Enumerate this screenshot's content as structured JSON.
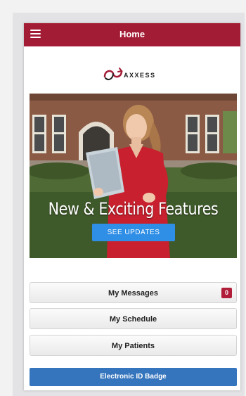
{
  "header": {
    "title": "Home",
    "background": "#a31c36",
    "menu_icon": "hamburger-icon"
  },
  "logo": {
    "text": "AXXESS",
    "accent": "#a31c36"
  },
  "hero": {
    "title": "New & Exciting Features",
    "button_label": "SEE UPDATES",
    "button_color": "#2f8ee5"
  },
  "menu": {
    "items": [
      {
        "label": "My Messages",
        "badge": "0"
      },
      {
        "label": "My Schedule"
      },
      {
        "label": "My Patients"
      }
    ],
    "badge_color": "#b01e3a"
  },
  "footer": {
    "id_badge_label": "Electronic ID Badge",
    "color": "#3575bd"
  }
}
